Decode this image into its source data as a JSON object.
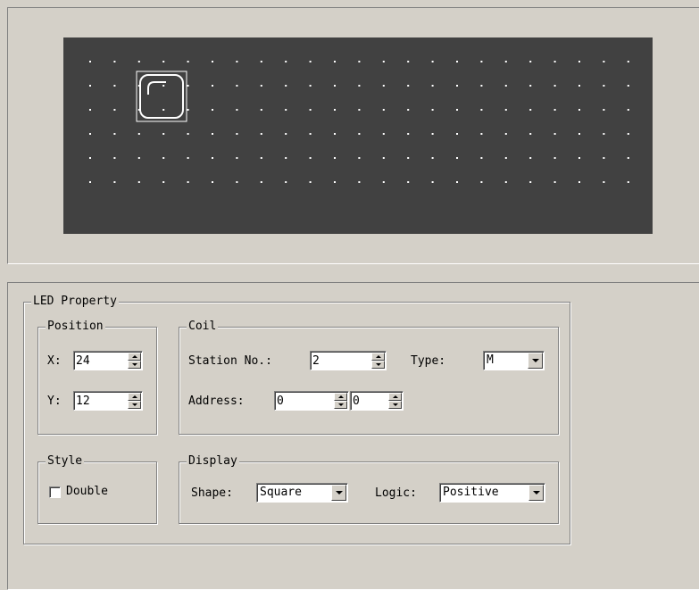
{
  "canvas": {
    "background": "#414141",
    "dot_color": "#ffffff",
    "led_shape": "square"
  },
  "led_property": {
    "title": "LED Property",
    "position": {
      "title": "Position",
      "x_label": "X:",
      "x_value": "24",
      "y_label": "Y:",
      "y_value": "12"
    },
    "coil": {
      "title": "Coil",
      "station_label": "Station No.:",
      "station_value": "2",
      "type_label": "Type:",
      "type_value": "M",
      "address_label": "Address:",
      "address_value": "0",
      "address_bit_value": "0"
    },
    "style": {
      "title": "Style",
      "double_label": "Double",
      "double_checked": false
    },
    "display": {
      "title": "Display",
      "shape_label": "Shape:",
      "shape_value": "Square",
      "logic_label": "Logic:",
      "logic_value": "Positive"
    }
  }
}
